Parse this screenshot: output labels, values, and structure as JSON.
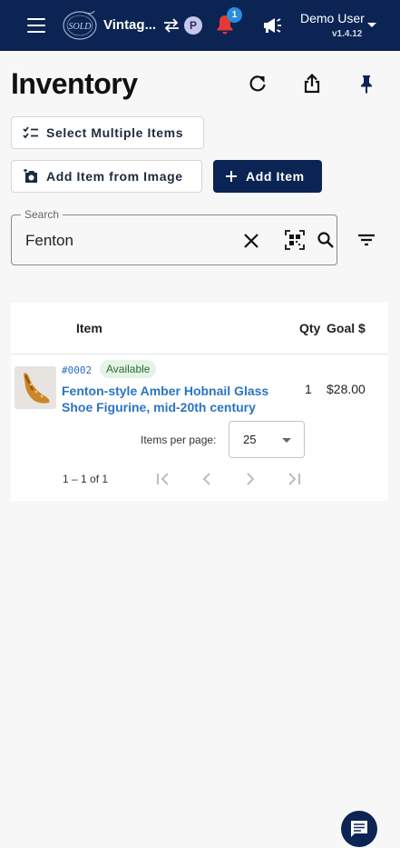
{
  "topbar": {
    "shop_name": "Vintag...",
    "profile_badge": "P",
    "notifications_count": "1",
    "user_name": "Demo User",
    "version": "v1.4.12",
    "logo_text": "SOLD"
  },
  "page": {
    "title": "Inventory"
  },
  "actions": {
    "select_multiple": "Select Multiple Items",
    "add_from_image": "Add Item from Image",
    "add_item": "Add Item"
  },
  "search": {
    "label": "Search",
    "value": "Fenton"
  },
  "table": {
    "columns": {
      "item": "Item",
      "qty": "Qty",
      "goal": "Goal $"
    },
    "rows": [
      {
        "id": "#0002",
        "status": "Available",
        "title": "Fenton-style Amber Hobnail Glass Shoe Figurine, mid-20th century",
        "qty": "1",
        "goal": "$28.00"
      }
    ]
  },
  "pagination": {
    "items_per_page_label": "Items per page:",
    "items_per_page": "25",
    "range": "1 – 1 of 1"
  },
  "colors": {
    "navy": "#0b2454",
    "link_blue": "#2a74c4",
    "notification_red": "#e53935",
    "chip_green_bg": "#e4f4e6"
  }
}
